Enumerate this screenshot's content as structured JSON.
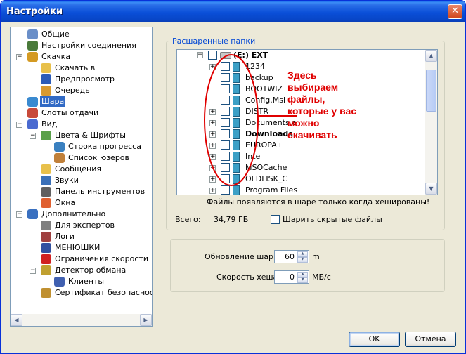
{
  "window": {
    "title": "Настройки",
    "close_label": "✕"
  },
  "tree": {
    "items": [
      {
        "label": "Общие",
        "icon": "users-icon"
      },
      {
        "label": "Настройки соединения",
        "icon": "network-icon"
      },
      {
        "label": "Скачка",
        "icon": "download-icon"
      },
      {
        "label": "Скачать в",
        "icon": "folder-icon"
      },
      {
        "label": "Предпросмотр",
        "icon": "preview-icon"
      },
      {
        "label": "Очередь",
        "icon": "queue-icon"
      },
      {
        "label": "Шара",
        "icon": "share-icon"
      },
      {
        "label": "Слоты отдачи",
        "icon": "slots-icon"
      },
      {
        "label": "Вид",
        "icon": "view-icon"
      },
      {
        "label": "Цвета & Шрифты",
        "icon": "colors-icon"
      },
      {
        "label": "Строка прогресса",
        "icon": "progress-icon"
      },
      {
        "label": "Список юзеров",
        "icon": "user-icon"
      },
      {
        "label": "Сообщения",
        "icon": "messages-icon"
      },
      {
        "label": "Звуки",
        "icon": "sound-icon"
      },
      {
        "label": "Панель инструментов",
        "icon": "toolbar-icon"
      },
      {
        "label": "Окна",
        "icon": "windows-icon"
      },
      {
        "label": "Дополнительно",
        "icon": "advanced-icon"
      },
      {
        "label": "Для экспертов",
        "icon": "expert-icon"
      },
      {
        "label": "Логи",
        "icon": "logs-icon"
      },
      {
        "label": "МЕНЮШКИ",
        "icon": "menu-icon"
      },
      {
        "label": "Ограничения скорости",
        "icon": "speed-limit-icon"
      },
      {
        "label": "Детектор обмана",
        "icon": "lock-icon"
      },
      {
        "label": "Клиенты",
        "icon": "clients-icon"
      },
      {
        "label": "Сертификат безопасности",
        "icon": "certificate-icon"
      }
    ]
  },
  "shared": {
    "legend": "Расшаренные папки",
    "root_label": "(E:) EXT",
    "folders": [
      "1234",
      "backup",
      "BOOTWIZ",
      "Config.Msi",
      "DISTR",
      "Documents a",
      "Downloads",
      "EUROPA+",
      "Inte",
      "MSOCache",
      "OLDLISK_C",
      "Program Files"
    ],
    "hint": "Файлы появляются в шаре только когда хешированы!",
    "total_label": "Всего:",
    "total_value": "34,79 ГБ",
    "hidden_files_label": "Шарить скрытые файлы"
  },
  "annotation": {
    "lines": [
      "Здесь",
      "выбираем",
      "файлы,",
      "которые у вас",
      "можно",
      "скачивать"
    ]
  },
  "settings": {
    "update_label": "Обновление шары",
    "update_value": "60",
    "update_unit": "m",
    "hash_label": "Скорость хеша",
    "hash_value": "0",
    "hash_unit": "МБ/с"
  },
  "buttons": {
    "ok": "OK",
    "cancel": "Отмена"
  }
}
